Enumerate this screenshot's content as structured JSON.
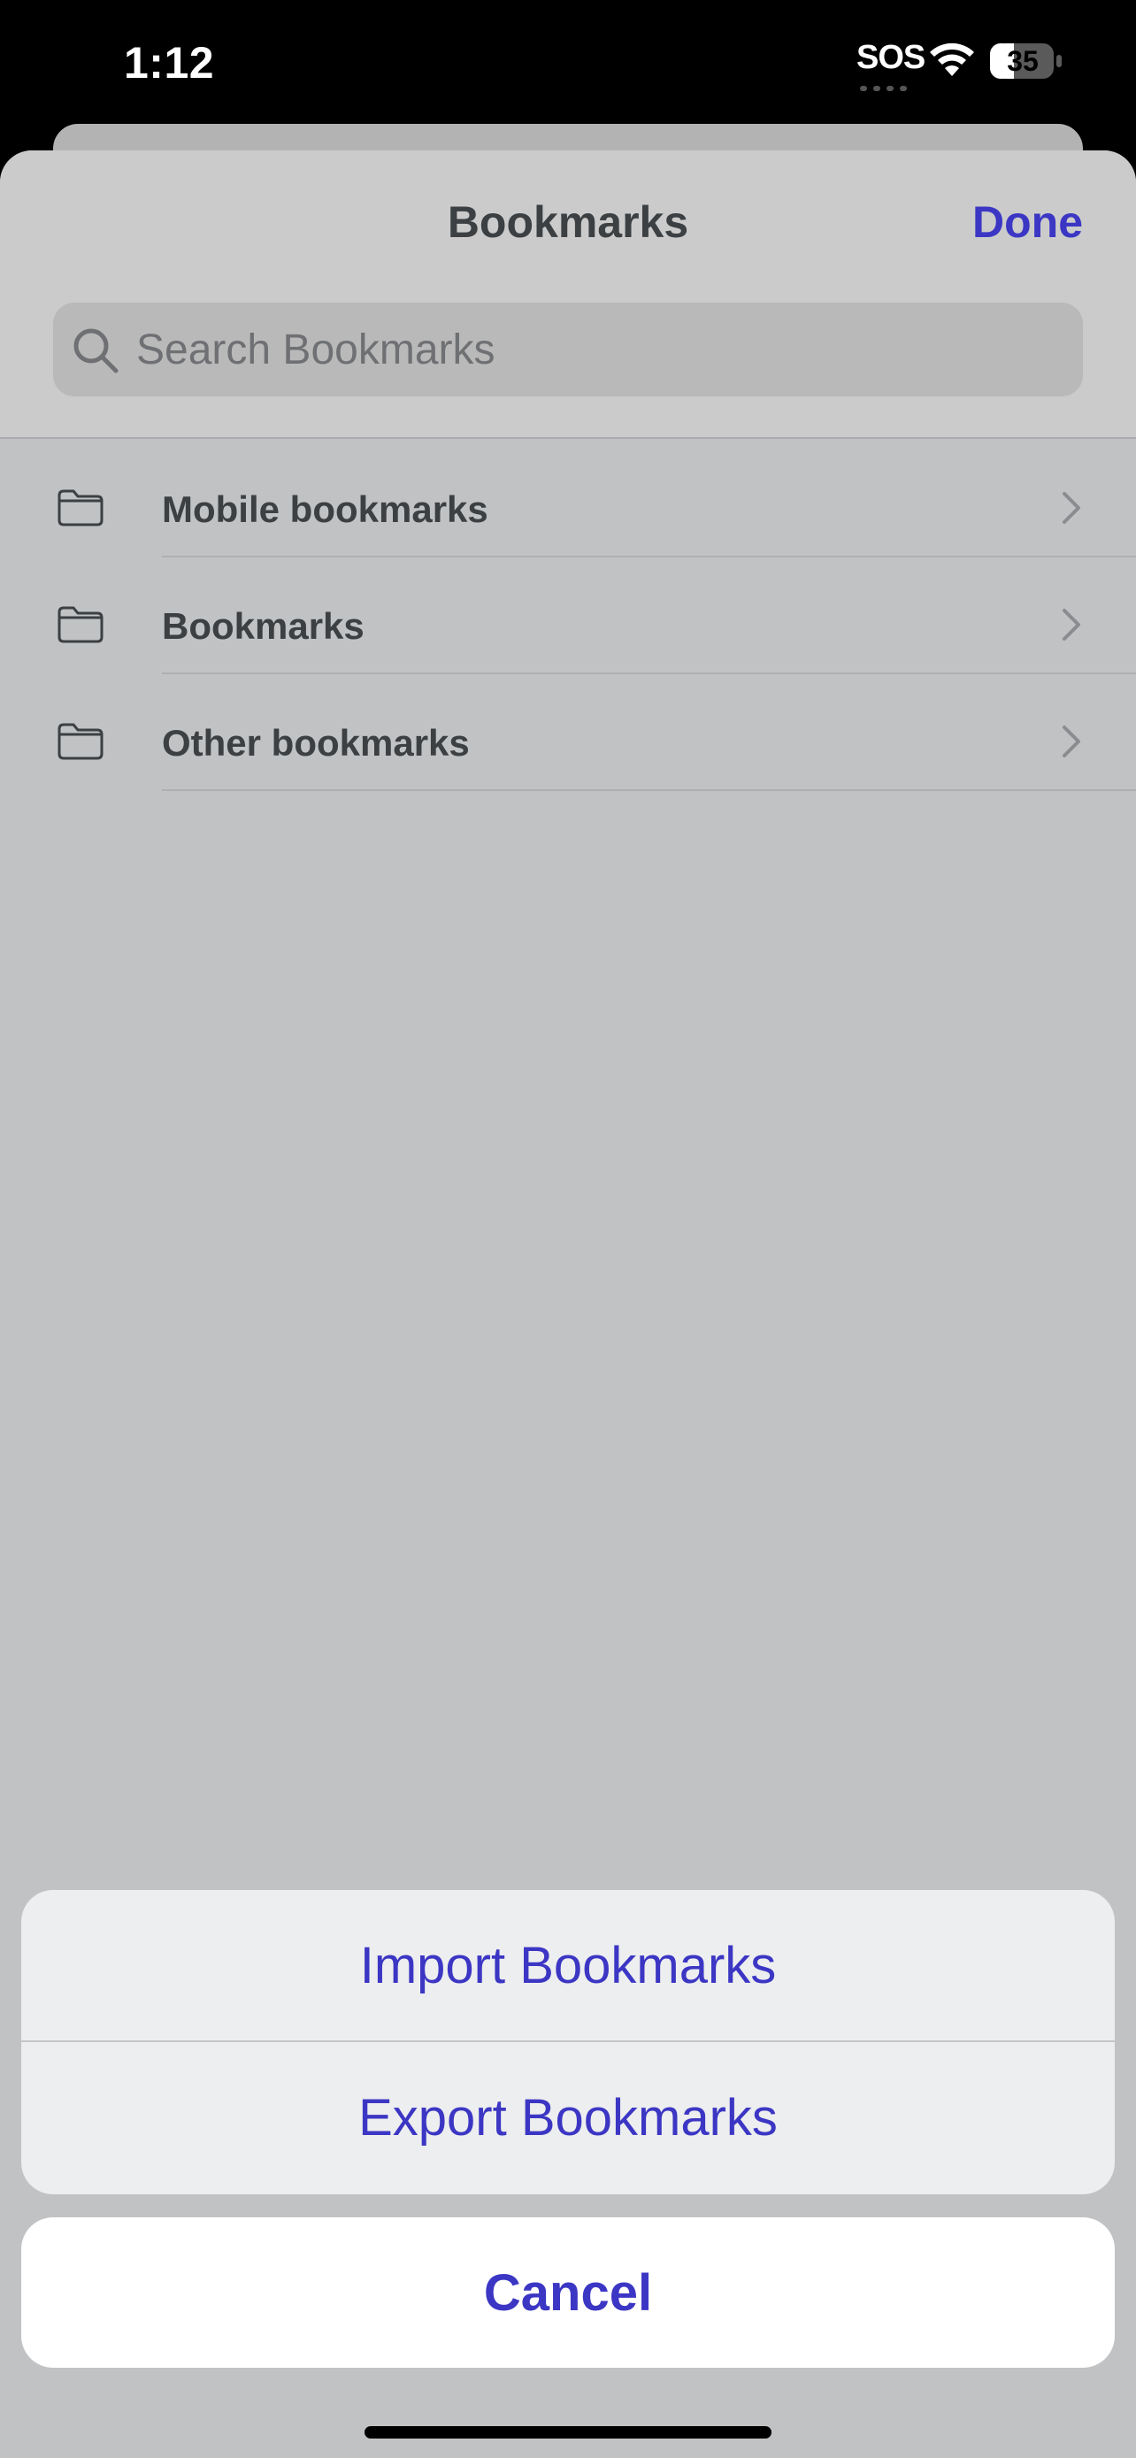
{
  "status_bar": {
    "time": "1:12",
    "sos": "SOS",
    "battery": "35"
  },
  "header": {
    "title": "Bookmarks",
    "done_label": "Done"
  },
  "search": {
    "placeholder": "Search Bookmarks",
    "value": ""
  },
  "folders": [
    {
      "label": "Mobile bookmarks",
      "icon": "folder-icon"
    },
    {
      "label": "Bookmarks",
      "icon": "folder-icon"
    },
    {
      "label": "Other bookmarks",
      "icon": "folder-icon"
    }
  ],
  "action_sheet": {
    "import_label": "Import Bookmarks",
    "export_label": "Export Bookmarks",
    "cancel_label": "Cancel"
  },
  "colors": {
    "accent": "#3c36c4",
    "text": "#3c4043",
    "sheet_background": "#c1c2c4",
    "action_background": "#edeeef"
  }
}
